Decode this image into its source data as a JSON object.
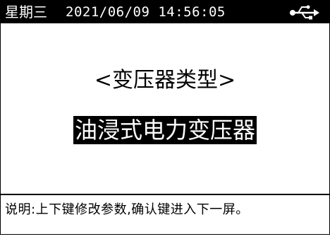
{
  "status_bar": {
    "weekday": "星期三",
    "datetime": "2021/06/09 14:56:05",
    "connection_icon": "usb-icon"
  },
  "main": {
    "parameter_name": "<变压器类型>",
    "parameter_value": "油浸式电力变压器"
  },
  "footer": {
    "help_text": "说明:上下键修改参数,确认键进入下一屏。"
  },
  "colors": {
    "background": "#ffffff",
    "foreground": "#000000",
    "highlight_background": "#000000",
    "highlight_text": "#ffffff"
  }
}
